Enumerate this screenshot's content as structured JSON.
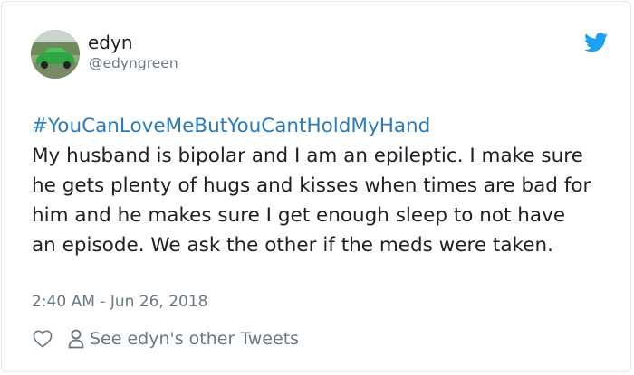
{
  "author": {
    "name": "edyn",
    "handle": "@edyngreen"
  },
  "tweet": {
    "hashtag": "#YouCanLoveMeButYouCantHoldMyHand",
    "body": "My husband is bipolar and I am an epileptic. I make sure he gets plenty of hugs and kisses when times are bad for him and he makes sure I get enough sleep to not have an episode. We ask the other if the meds were taken.",
    "timestamp": "2:40 AM - Jun 26, 2018"
  },
  "actions": {
    "other_tweets_label": "See edyn's other Tweets"
  },
  "colors": {
    "link": "#2b7bb9",
    "muted": "#697882",
    "brand": "#1da1f2"
  },
  "icons": [
    "heart-icon",
    "person-icon",
    "twitter-bird-icon"
  ]
}
